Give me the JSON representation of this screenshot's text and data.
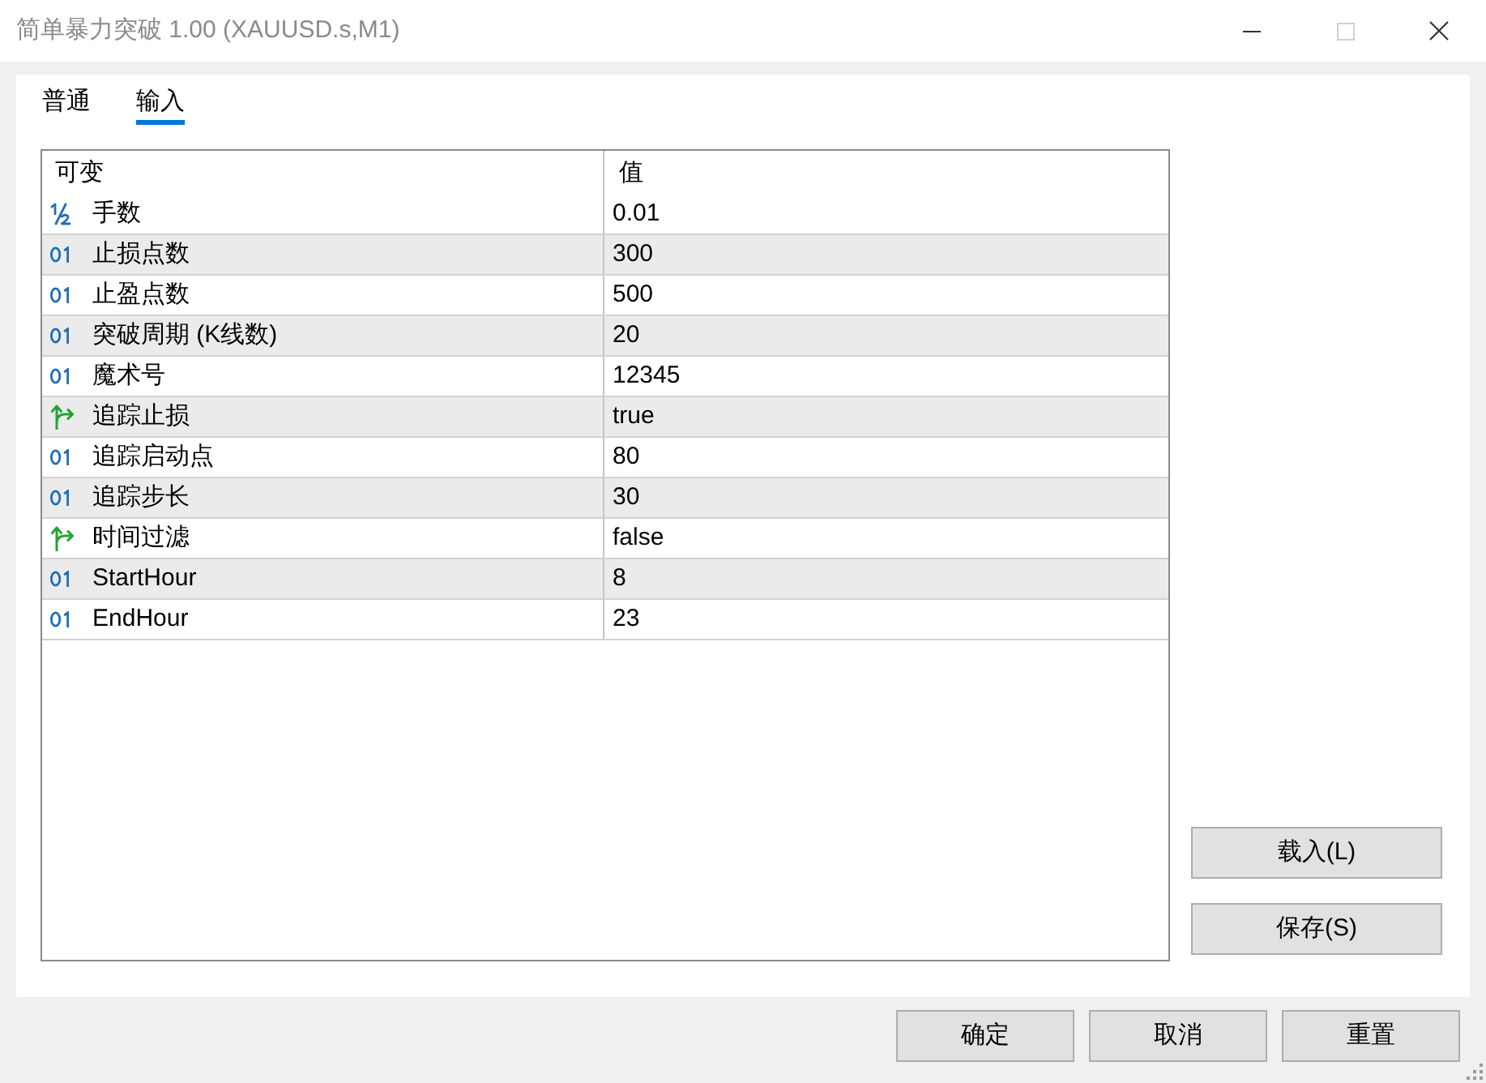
{
  "window": {
    "title": "简单暴力突破 1.00 (XAUUSD.s,M1)",
    "controls": [
      {
        "kind": "minimize",
        "disabled": false
      },
      {
        "kind": "maximize",
        "disabled": true
      },
      {
        "kind": "close",
        "disabled": false
      }
    ]
  },
  "tabs": [
    {
      "label": "普通",
      "selected": false
    },
    {
      "label": "输入",
      "selected": true
    }
  ],
  "table": {
    "columns": [
      "可变",
      "值"
    ],
    "rows": [
      {
        "kind": "double",
        "name": "手数",
        "value": "0.01"
      },
      {
        "kind": "int",
        "name": "止损点数",
        "value": "300"
      },
      {
        "kind": "int",
        "name": "止盈点数",
        "value": "500"
      },
      {
        "kind": "int",
        "name": "突破周期 (K线数)",
        "value": "20"
      },
      {
        "kind": "int",
        "name": "魔术号",
        "value": "12345"
      },
      {
        "kind": "bool",
        "name": "追踪止损",
        "value": "true"
      },
      {
        "kind": "int",
        "name": "追踪启动点",
        "value": "80"
      },
      {
        "kind": "int",
        "name": "追踪步长",
        "value": "30"
      },
      {
        "kind": "bool",
        "name": "时间过滤",
        "value": "false"
      },
      {
        "kind": "int",
        "name": "StartHour",
        "value": "8"
      },
      {
        "kind": "int",
        "name": "EndHour",
        "value": "23"
      }
    ]
  },
  "side_buttons": [
    "载入(L)",
    "保存(S)"
  ],
  "buttons": [
    "确定",
    "取消",
    "重置"
  ]
}
